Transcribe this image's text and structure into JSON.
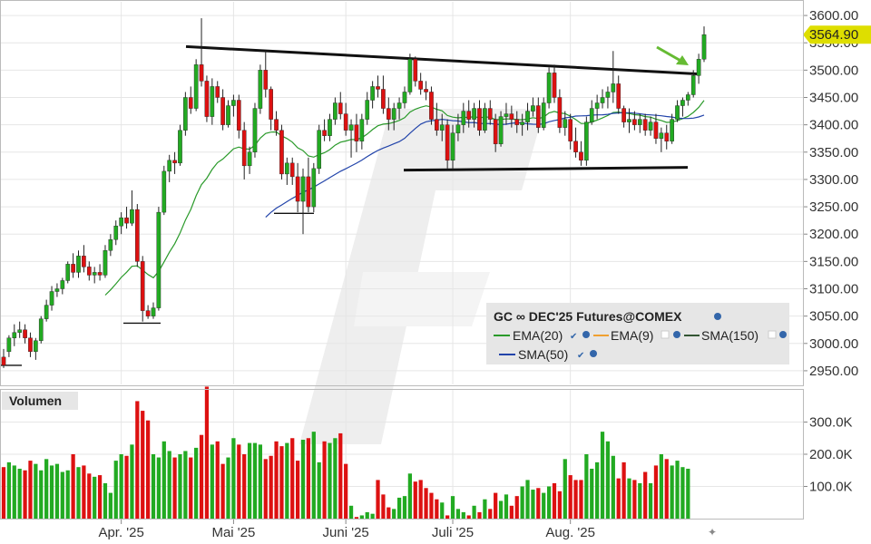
{
  "colors": {
    "up": "#22aa22",
    "down": "#dd1111",
    "ema20": "#2a9a2a",
    "ema9": "#f0a030",
    "sma150": "#335533",
    "sma50": "#2244aa",
    "badge": "#dede00",
    "arrow": "#66bb33",
    "grid": "#e6e6e6",
    "legend_bg": "#e6e6e6"
  },
  "chart_data": [
    {
      "type": "candlestick",
      "title": "",
      "y_ticks": [
        "2950.00",
        "3000.00",
        "3050.00",
        "3100.00",
        "3150.00",
        "3200.00",
        "3250.00",
        "3300.00",
        "3350.00",
        "3400.00",
        "3450.00",
        "3500.00",
        "3550.00",
        "3600.00"
      ],
      "y_tick_values": [
        2950,
        3000,
        3050,
        3100,
        3150,
        3200,
        3250,
        3300,
        3350,
        3400,
        3450,
        3500,
        3550,
        3600
      ],
      "ylim": [
        2925,
        3625
      ],
      "x_ticks": [
        {
          "label": "Apr. '25",
          "index": 22
        },
        {
          "label": "Mai '25",
          "index": 43
        },
        {
          "label": "Juni '25",
          "index": 64
        },
        {
          "label": "Juli '25",
          "index": 84
        },
        {
          "label": "Aug. '25",
          "index": 106
        }
      ],
      "last_price": "3564.90",
      "last_price_value": 3564.9,
      "candles": [
        [
          2975,
          2990,
          2955,
          2960
        ],
        [
          2985,
          3015,
          2975,
          3010
        ],
        [
          3010,
          3035,
          2995,
          3020
        ],
        [
          3020,
          3040,
          3010,
          3025
        ],
        [
          3025,
          3035,
          3000,
          3010
        ],
        [
          3010,
          3020,
          2975,
          2985
        ],
        [
          2985,
          3010,
          2970,
          3005
        ],
        [
          3005,
          3050,
          3000,
          3045
        ],
        [
          3045,
          3080,
          3040,
          3070
        ],
        [
          3070,
          3105,
          3060,
          3095
        ],
        [
          3095,
          3110,
          3085,
          3100
        ],
        [
          3100,
          3120,
          3090,
          3115
        ],
        [
          3115,
          3150,
          3110,
          3145
        ],
        [
          3145,
          3165,
          3120,
          3130
        ],
        [
          3130,
          3170,
          3120,
          3160
        ],
        [
          3160,
          3180,
          3130,
          3140
        ],
        [
          3140,
          3150,
          3115,
          3125
        ],
        [
          3125,
          3140,
          3110,
          3130
        ],
        [
          3130,
          3145,
          3115,
          3125
        ],
        [
          3125,
          3180,
          3120,
          3170
        ],
        [
          3170,
          3200,
          3160,
          3190
        ],
        [
          3190,
          3225,
          3180,
          3215
        ],
        [
          3215,
          3240,
          3200,
          3230
        ],
        [
          3230,
          3250,
          3210,
          3220
        ],
        [
          3220,
          3280,
          3215,
          3245
        ],
        [
          3245,
          3255,
          3140,
          3150
        ],
        [
          3150,
          3160,
          3040,
          3060
        ],
        [
          3060,
          3070,
          3045,
          3050
        ],
        [
          3050,
          3075,
          3045,
          3065
        ],
        [
          3065,
          3250,
          3060,
          3240
        ],
        [
          3240,
          3325,
          3235,
          3315
        ],
        [
          3315,
          3345,
          3295,
          3335
        ],
        [
          3335,
          3350,
          3310,
          3330
        ],
        [
          3330,
          3400,
          3325,
          3390
        ],
        [
          3390,
          3460,
          3380,
          3450
        ],
        [
          3450,
          3470,
          3420,
          3430
        ],
        [
          3430,
          3520,
          3425,
          3510
        ],
        [
          3510,
          3595,
          3470,
          3480
        ],
        [
          3480,
          3490,
          3405,
          3415
        ],
        [
          3415,
          3485,
          3400,
          3470
        ],
        [
          3470,
          3480,
          3440,
          3450
        ],
        [
          3450,
          3465,
          3390,
          3400
        ],
        [
          3400,
          3445,
          3395,
          3435
        ],
        [
          3435,
          3455,
          3415,
          3445
        ],
        [
          3445,
          3455,
          3375,
          3390
        ],
        [
          3390,
          3405,
          3300,
          3325
        ],
        [
          3325,
          3360,
          3310,
          3350
        ],
        [
          3350,
          3440,
          3340,
          3430
        ],
        [
          3430,
          3510,
          3420,
          3500
        ],
        [
          3500,
          3535,
          3450,
          3465
        ],
        [
          3465,
          3470,
          3390,
          3410
        ],
        [
          3410,
          3425,
          3380,
          3390
        ],
        [
          3390,
          3400,
          3300,
          3310
        ],
        [
          3310,
          3340,
          3290,
          3330
        ],
        [
          3330,
          3340,
          3290,
          3305
        ],
        [
          3305,
          3330,
          3240,
          3260
        ],
        [
          3260,
          3320,
          3200,
          3305
        ],
        [
          3305,
          3340,
          3240,
          3250
        ],
        [
          3250,
          3330,
          3240,
          3320
        ],
        [
          3320,
          3400,
          3310,
          3390
        ],
        [
          3390,
          3410,
          3370,
          3380
        ],
        [
          3380,
          3420,
          3370,
          3410
        ],
        [
          3410,
          3450,
          3400,
          3440
        ],
        [
          3440,
          3460,
          3410,
          3420
        ],
        [
          3420,
          3440,
          3380,
          3390
        ],
        [
          3390,
          3410,
          3340,
          3400
        ],
        [
          3400,
          3420,
          3350,
          3370
        ],
        [
          3370,
          3420,
          3355,
          3410
        ],
        [
          3410,
          3460,
          3400,
          3445
        ],
        [
          3445,
          3480,
          3430,
          3470
        ],
        [
          3470,
          3490,
          3450,
          3465
        ],
        [
          3465,
          3490,
          3420,
          3430
        ],
        [
          3430,
          3450,
          3390,
          3410
        ],
        [
          3410,
          3440,
          3390,
          3430
        ],
        [
          3430,
          3450,
          3410,
          3440
        ],
        [
          3440,
          3470,
          3430,
          3460
        ],
        [
          3460,
          3530,
          3455,
          3520
        ],
        [
          3520,
          3525,
          3470,
          3480
        ],
        [
          3480,
          3495,
          3455,
          3465
        ],
        [
          3465,
          3480,
          3445,
          3460
        ],
        [
          3460,
          3470,
          3400,
          3410
        ],
        [
          3410,
          3440,
          3380,
          3390
        ],
        [
          3390,
          3420,
          3370,
          3400
        ],
        [
          3400,
          3410,
          3320,
          3335
        ],
        [
          3335,
          3400,
          3320,
          3385
        ],
        [
          3385,
          3420,
          3370,
          3400
        ],
        [
          3400,
          3440,
          3385,
          3425
        ],
        [
          3425,
          3445,
          3395,
          3410
        ],
        [
          3410,
          3440,
          3395,
          3430
        ],
        [
          3430,
          3445,
          3380,
          3390
        ],
        [
          3390,
          3440,
          3385,
          3430
        ],
        [
          3430,
          3445,
          3400,
          3410
        ],
        [
          3410,
          3420,
          3350,
          3365
        ],
        [
          3365,
          3425,
          3360,
          3415
        ],
        [
          3415,
          3440,
          3400,
          3420
        ],
        [
          3420,
          3435,
          3395,
          3410
        ],
        [
          3410,
          3425,
          3385,
          3400
        ],
        [
          3400,
          3420,
          3380,
          3405
        ],
        [
          3405,
          3440,
          3390,
          3425
        ],
        [
          3425,
          3450,
          3415,
          3435
        ],
        [
          3435,
          3450,
          3385,
          3395
        ],
        [
          3395,
          3450,
          3390,
          3440
        ],
        [
          3440,
          3505,
          3430,
          3495
        ],
        [
          3495,
          3510,
          3440,
          3450
        ],
        [
          3450,
          3465,
          3385,
          3395
        ],
        [
          3395,
          3425,
          3380,
          3410
        ],
        [
          3410,
          3420,
          3355,
          3370
        ],
        [
          3370,
          3395,
          3340,
          3350
        ],
        [
          3350,
          3370,
          3325,
          3335
        ],
        [
          3335,
          3415,
          3325,
          3405
        ],
        [
          3405,
          3445,
          3400,
          3430
        ],
        [
          3430,
          3455,
          3410,
          3440
        ],
        [
          3440,
          3465,
          3430,
          3450
        ],
        [
          3450,
          3470,
          3430,
          3460
        ],
        [
          3460,
          3535,
          3440,
          3475
        ],
        [
          3475,
          3490,
          3420,
          3430
        ],
        [
          3430,
          3435,
          3395,
          3405
        ],
        [
          3405,
          3430,
          3385,
          3410
        ],
        [
          3410,
          3425,
          3390,
          3400
        ],
        [
          3400,
          3420,
          3385,
          3410
        ],
        [
          3410,
          3420,
          3380,
          3390
        ],
        [
          3390,
          3415,
          3380,
          3405
        ],
        [
          3405,
          3420,
          3365,
          3375
        ],
        [
          3375,
          3395,
          3350,
          3385
        ],
        [
          3385,
          3400,
          3355,
          3370
        ],
        [
          3370,
          3420,
          3365,
          3410
        ],
        [
          3410,
          3445,
          3405,
          3435
        ],
        [
          3435,
          3450,
          3415,
          3445
        ],
        [
          3445,
          3460,
          3435,
          3455
        ],
        [
          3455,
          3500,
          3450,
          3490
        ],
        [
          3490,
          3530,
          3475,
          3520
        ],
        [
          3520,
          3580,
          3515,
          3565
        ]
      ],
      "sma50": [
        null,
        null,
        null,
        null,
        null,
        null,
        null,
        null,
        null,
        null,
        null,
        null,
        null,
        null,
        null,
        null,
        null,
        null,
        null,
        null,
        null,
        null,
        null,
        null,
        null,
        null,
        null,
        null,
        null,
        null,
        null,
        null,
        null,
        null,
        null,
        null,
        null,
        null,
        null,
        null,
        null,
        null,
        null,
        null,
        null,
        null,
        null,
        null,
        null,
        3240,
        3246,
        3251,
        3255,
        3260,
        3263,
        3267,
        3270,
        3273,
        3278,
        3284,
        3290,
        3296,
        3303,
        3309,
        3315,
        3322,
        3328,
        3334,
        3341,
        3348,
        3355,
        3361,
        3367,
        3372,
        3377,
        3382,
        3386,
        3390,
        3393,
        3396,
        3398,
        3399,
        3400,
        3400,
        3401,
        3402,
        3403,
        3404,
        3405,
        3406,
        3406,
        3407,
        3407,
        3408,
        3408,
        3409,
        3409,
        3410,
        3410,
        3411,
        3411,
        3411,
        3412,
        3412,
        3412,
        3411,
        3411,
        3410,
        3409,
        3408,
        3408,
        3409,
        3410,
        3411,
        3412,
        3413,
        3413,
        3412,
        3411,
        3410,
        3409,
        3409,
        3408,
        3408,
        3407,
        3407,
        3407,
        3408,
        3409,
        3410,
        3411,
        3412,
        3413,
        3414
      ],
      "sma50_start": 27
    },
    {
      "type": "bar",
      "title": "Volumen",
      "y_ticks": [
        "100.0K",
        "200.0K",
        "300.0K"
      ],
      "y_tick_values": [
        100000,
        200000,
        300000
      ],
      "ylim": [
        0,
        400000
      ],
      "values": [
        160000,
        175000,
        165000,
        155000,
        150000,
        180000,
        170000,
        150000,
        185000,
        165000,
        170000,
        145000,
        150000,
        200000,
        160000,
        165000,
        140000,
        130000,
        135000,
        110000,
        80000,
        180000,
        200000,
        195000,
        230000,
        365000,
        335000,
        305000,
        200000,
        190000,
        240000,
        210000,
        190000,
        200000,
        210000,
        190000,
        220000,
        260000,
        410000,
        230000,
        240000,
        170000,
        190000,
        250000,
        230000,
        200000,
        235000,
        235000,
        230000,
        185000,
        195000,
        240000,
        225000,
        235000,
        250000,
        180000,
        245000,
        250000,
        270000,
        175000,
        240000,
        235000,
        250000,
        265000,
        170000,
        40000,
        5000,
        10000,
        20000,
        15000,
        120000,
        75000,
        35000,
        30000,
        65000,
        70000,
        140000,
        115000,
        120000,
        95000,
        80000,
        60000,
        50000,
        10000,
        70000,
        30000,
        20000,
        10000,
        40000,
        20000,
        60000,
        30000,
        80000,
        55000,
        75000,
        40000,
        70000,
        100000,
        120000,
        90000,
        95000,
        80000,
        100000,
        110000,
        85000,
        185000,
        135000,
        120000,
        120000,
        200000,
        155000,
        175000,
        270000,
        240000,
        195000,
        125000,
        175000,
        125000,
        120000,
        110000,
        145000,
        110000,
        165000,
        200000,
        185000,
        165000,
        180000,
        160000,
        155000
      ],
      "up_flags_start": 0
    }
  ],
  "legend": {
    "title": "GC ∞ DEC'25 Futures@COMEX",
    "items": [
      {
        "label": "EMA(20)",
        "checked": true
      },
      {
        "label": "EMA(9)",
        "checked": false
      },
      {
        "label": "SMA(150)",
        "checked": false
      },
      {
        "label": "SMA(50)",
        "checked": true
      }
    ]
  }
}
